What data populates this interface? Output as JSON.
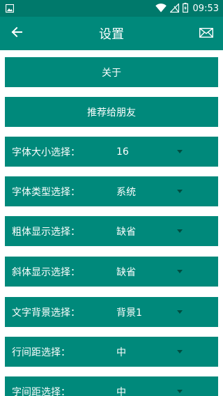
{
  "status_bar": {
    "time": "09:53",
    "left_icons": [
      "image-notification-icon"
    ],
    "right_icons": [
      "wifi-icon",
      "no-signal-icon",
      "battery-charging-icon"
    ]
  },
  "app_bar": {
    "title": "设置",
    "back_icon": "back-arrow-icon",
    "mail_icon": "mail-icon"
  },
  "buttons": {
    "about": "关于",
    "recommend": "推荐给朋友"
  },
  "settings": [
    {
      "label": "字体大小选择：",
      "value": "16"
    },
    {
      "label": "字体类型选择：",
      "value": "系统"
    },
    {
      "label": "粗体显示选择：",
      "value": "缺省"
    },
    {
      "label": "斜体显示选择：",
      "value": "缺省"
    },
    {
      "label": "文字背景选择：",
      "value": "背景1"
    },
    {
      "label": "行间距选择：",
      "value": "中"
    },
    {
      "label": "字间距选择：",
      "value": "中"
    }
  ],
  "colors": {
    "status_bar": "#00796b",
    "primary": "#00897b",
    "arrow": "#004d40"
  }
}
